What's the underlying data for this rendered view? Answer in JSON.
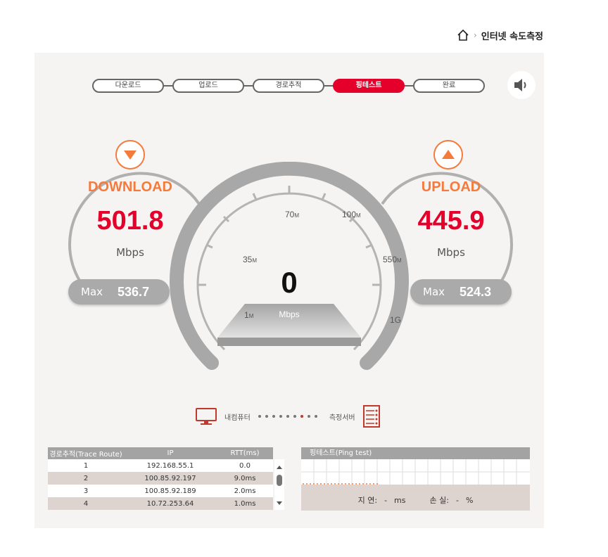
{
  "breadcrumb": {
    "current": "인터넷 속도측정"
  },
  "steps": [
    {
      "label": "다운로드",
      "active": false
    },
    {
      "label": "업로드",
      "active": false
    },
    {
      "label": "경로추적",
      "active": false
    },
    {
      "label": "핑테스트",
      "active": true
    },
    {
      "label": "완료",
      "active": false
    }
  ],
  "download": {
    "title": "DOWNLOAD",
    "value": "501.8",
    "unit": "Mbps",
    "max_label": "Max",
    "max_value": "536.7"
  },
  "upload": {
    "title": "UPLOAD",
    "value": "445.9",
    "unit": "Mbps",
    "max_label": "Max",
    "max_value": "524.3"
  },
  "gauge": {
    "value": "0",
    "unit": "Mbps",
    "ticks": [
      {
        "num": "1",
        "suffix": "M"
      },
      {
        "num": "35",
        "suffix": "M"
      },
      {
        "num": "70",
        "suffix": "M"
      },
      {
        "num": "100",
        "suffix": "M"
      },
      {
        "num": "550",
        "suffix": "M"
      },
      {
        "num": "1G",
        "suffix": ""
      }
    ]
  },
  "network": {
    "client_label": "내컴퓨터",
    "server_label": "측정서버"
  },
  "trace": {
    "headers": [
      "경로추적(Trace Route)",
      "IP",
      "RTT(ms)"
    ],
    "rows": [
      [
        "1",
        "192.168.55.1",
        "0.0"
      ],
      [
        "2",
        "100.85.92.197",
        "9.0ms"
      ],
      [
        "3",
        "100.85.92.189",
        "2.0ms"
      ],
      [
        "4",
        "10.72.253.64",
        "1.0ms"
      ]
    ]
  },
  "ping": {
    "title": "핑테스트(Ping test)",
    "latency_label": "지 연:",
    "latency_value": "-",
    "latency_unit": "ms",
    "loss_label": "손 실:",
    "loss_value": "-",
    "loss_unit": "%"
  },
  "colors": {
    "accent": "#e4002b",
    "orange": "#f47b3c",
    "gray": "#a3a3a3"
  }
}
